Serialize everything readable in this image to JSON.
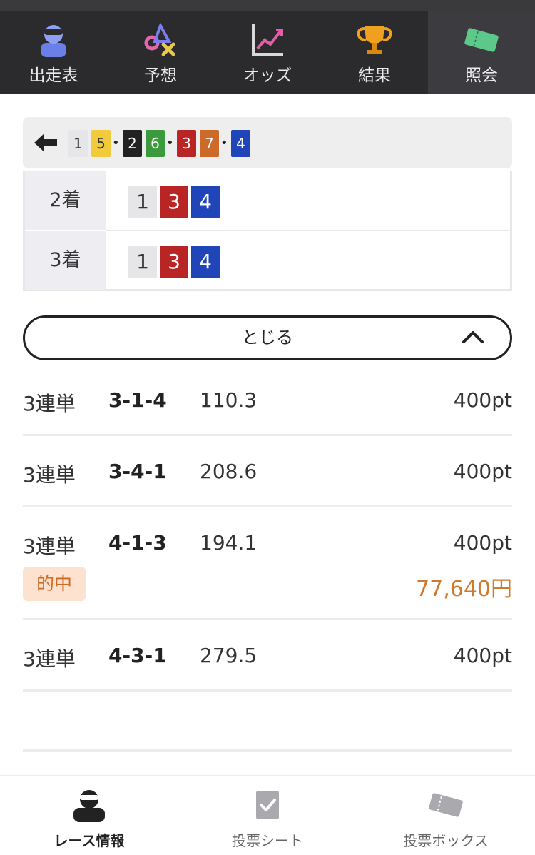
{
  "top_nav": {
    "tabs": [
      {
        "label": "出走表",
        "icon": "racer-icon"
      },
      {
        "label": "予想",
        "icon": "prediction-icon"
      },
      {
        "label": "オッズ",
        "icon": "odds-chart-icon"
      },
      {
        "label": "結果",
        "icon": "trophy-icon"
      },
      {
        "label": "照会",
        "icon": "ticket-icon",
        "active": true
      }
    ]
  },
  "combination": {
    "back_icon": "back-arrow-icon",
    "groups": [
      [
        "1",
        "5"
      ],
      [
        "2",
        "6"
      ],
      [
        "3",
        "7"
      ],
      [
        "4"
      ]
    ],
    "separator": "•"
  },
  "places": [
    {
      "label": "2着",
      "boats": [
        "1",
        "3",
        "4"
      ]
    },
    {
      "label": "3着",
      "boats": [
        "1",
        "3",
        "4"
      ]
    }
  ],
  "close_button": {
    "label": "とじる",
    "icon": "chevron-up-icon"
  },
  "bets": [
    {
      "type": "3連単",
      "combo": "3-1-4",
      "odds": "110.3",
      "amount": "400pt"
    },
    {
      "type": "3連単",
      "combo": "3-4-1",
      "odds": "208.6",
      "amount": "400pt"
    },
    {
      "type": "3連単",
      "combo": "4-1-3",
      "odds": "194.1",
      "amount": "400pt",
      "hit_label": "的中",
      "payout": "77,640円"
    },
    {
      "type": "3連単",
      "combo": "4-3-1",
      "odds": "279.5",
      "amount": "400pt"
    }
  ],
  "bottom_nav": {
    "items": [
      {
        "label": "レース情報",
        "icon": "racer-silhouette-icon",
        "active": true
      },
      {
        "label": "投票シート",
        "icon": "checked-sheet-icon"
      },
      {
        "label": "投票ボックス",
        "icon": "ticket-box-icon"
      }
    ]
  },
  "colors": {
    "boat_1": "#e6e6e8",
    "boat_2": "#222222",
    "boat_3": "#b92525",
    "boat_4": "#1f45b8",
    "boat_5": "#f2cb3a",
    "boat_6": "#3b9a3b",
    "boat_7": "#cc6a2a",
    "accent_hit": "#d07a2e",
    "nav_bg": "#2b2b2d"
  }
}
